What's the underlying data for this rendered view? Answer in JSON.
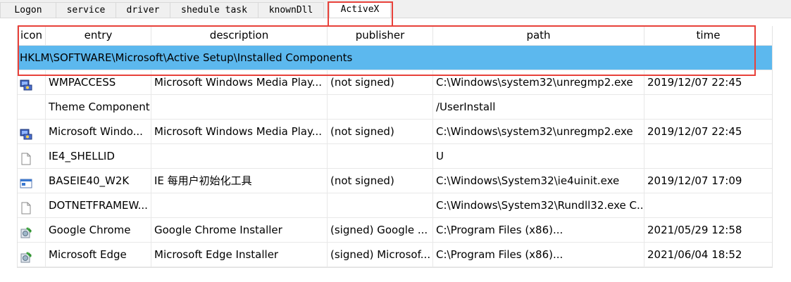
{
  "tabs": [
    {
      "label": "Logon"
    },
    {
      "label": "service"
    },
    {
      "label": "driver"
    },
    {
      "label": "shedule task"
    },
    {
      "label": "knownDll"
    },
    {
      "label": "ActiveX",
      "active": true
    }
  ],
  "table": {
    "columns": [
      "icon",
      "entry",
      "description",
      "publisher",
      "path",
      "time"
    ],
    "group_label": "HKLM\\SOFTWARE\\Microsoft\\Active Setup\\Installed Components",
    "rows": [
      {
        "icon": "media-player-icon",
        "entry": "WMPACCESS",
        "description": "Microsoft Windows Media Play...",
        "publisher": "(not signed)",
        "path": "C:\\Windows\\system32\\unregmp2.exe",
        "time": "2019/12/07 22:45"
      },
      {
        "icon": "none",
        "entry": "Theme Component",
        "description": "",
        "publisher": "",
        "path": "/UserInstall",
        "time": ""
      },
      {
        "icon": "media-player-icon",
        "entry": "Microsoft Windo...",
        "description": "Microsoft Windows Media Play...",
        "publisher": "(not signed)",
        "path": "C:\\Windows\\system32\\unregmp2.exe",
        "time": "2019/12/07 22:45"
      },
      {
        "icon": "blank-file-icon",
        "entry": "IE4_SHELLID",
        "description": "",
        "publisher": "",
        "path": "U",
        "time": ""
      },
      {
        "icon": "window-app-icon",
        "entry": "BASEIE40_W2K",
        "description": "IE 每用户初始化工具",
        "publisher": "(not signed)",
        "path": "C:\\Windows\\System32\\ie4uinit.exe",
        "time": "2019/12/07 17:09"
      },
      {
        "icon": "blank-file-icon",
        "entry": "DOTNETFRAMEW...",
        "description": "",
        "publisher": "",
        "path": "C:\\Windows\\System32\\Rundll32.exe C...",
        "time": ""
      },
      {
        "icon": "installer-icon",
        "entry": "Google Chrome",
        "description": "Google Chrome Installer",
        "publisher": "(signed) Google ...",
        "path": "C:\\Program Files (x86)...",
        "time": "2021/05/29 12:58"
      },
      {
        "icon": "installer-icon",
        "entry": "Microsoft Edge",
        "description": "Microsoft Edge Installer",
        "publisher": "(signed) Microsof...",
        "path": "C:\\Program Files (x86)...",
        "time": "2021/06/04 18:52"
      }
    ]
  },
  "colors": {
    "group_highlight": "#5cb8ee",
    "annotation_red": "#e8413a"
  }
}
